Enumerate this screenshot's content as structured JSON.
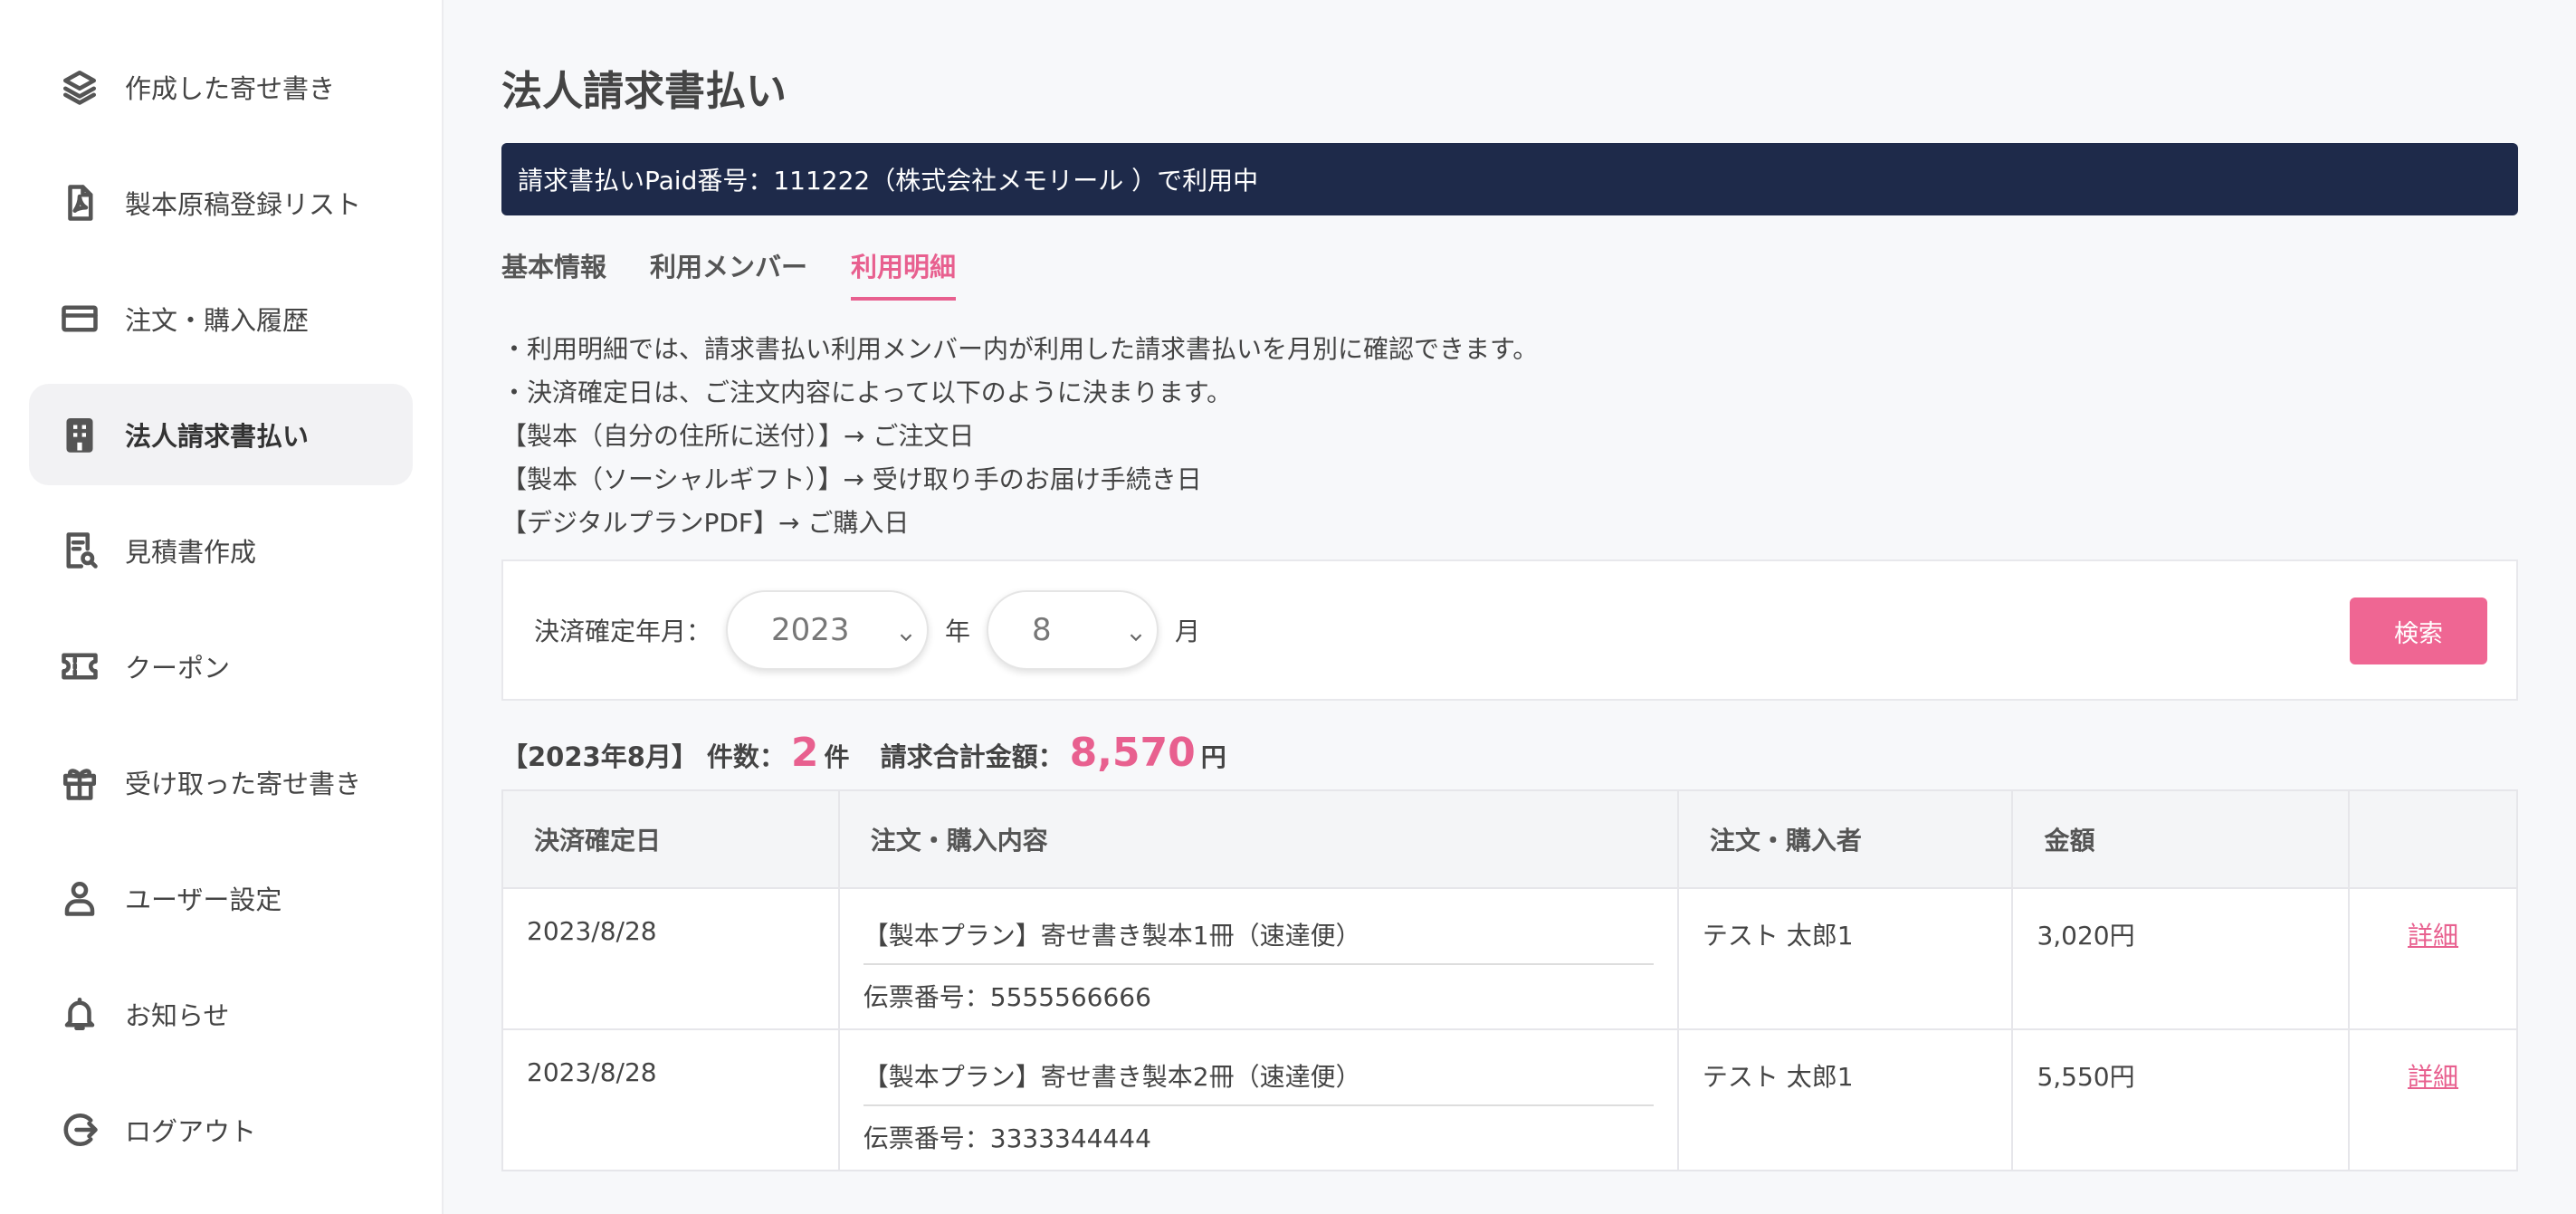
{
  "sidebar": {
    "items": [
      {
        "label": "作成した寄せ書き"
      },
      {
        "label": "製本原稿登録リスト"
      },
      {
        "label": "注文・購入履歴"
      },
      {
        "label": "法人請求書払い"
      },
      {
        "label": "見積書作成"
      },
      {
        "label": "クーポン"
      },
      {
        "label": "受け取った寄せ書き"
      },
      {
        "label": "ユーザー設定"
      },
      {
        "label": "お知らせ"
      },
      {
        "label": "ログアウト"
      }
    ]
  },
  "main": {
    "title": "法人請求書払い",
    "banner": "請求書払いPaid番号：111222（株式会社メモリール ）で利用中",
    "tabs": [
      {
        "label": "基本情報"
      },
      {
        "label": "利用メンバー"
      },
      {
        "label": "利用明細"
      }
    ],
    "notes": [
      "・利用明細では、請求書払い利用メンバー内が利用した請求書払いを月別に確認できます。",
      "・決済確定日は、ご注文内容によって以下のように決まります。",
      "【製本（自分の住所に送付）】→ ご注文日",
      "【製本（ソーシャルギフト）】→ 受け取り手のお届け手続き日",
      "【デジタルプランPDF】→ ご購入日"
    ],
    "filter": {
      "label": "決済確定年月：",
      "year_value": "2023",
      "year_unit": "年",
      "month_value": "8",
      "month_unit": "月",
      "search_label": "検索"
    },
    "summary": {
      "period": "【2023年8月】",
      "count_label": "件数：",
      "count": "2",
      "count_unit": "件",
      "total_label": "請求合計金額：",
      "total": "8,570",
      "total_unit": "円"
    },
    "table": {
      "headers": [
        "決済確定日",
        "注文・購入内容",
        "注文・購入者",
        "金額",
        ""
      ],
      "rows": [
        {
          "date": "2023/8/28",
          "item": "【製本プラン】寄せ書き製本1冊（速達便）",
          "slip": "伝票番号：5555566666",
          "buyer": "テスト 太郎1",
          "amount": "3,020円",
          "detail": "詳細"
        },
        {
          "date": "2023/8/28",
          "item": "【製本プラン】寄せ書き製本2冊（速達便）",
          "slip": "伝票番号：3333344444",
          "buyer": "テスト 太郎1",
          "amount": "5,550円",
          "detail": "詳細"
        }
      ]
    }
  },
  "colors": {
    "accent": "#e8608f",
    "banner_bg": "#1e2a4a",
    "button_bg": "#ef6693"
  }
}
